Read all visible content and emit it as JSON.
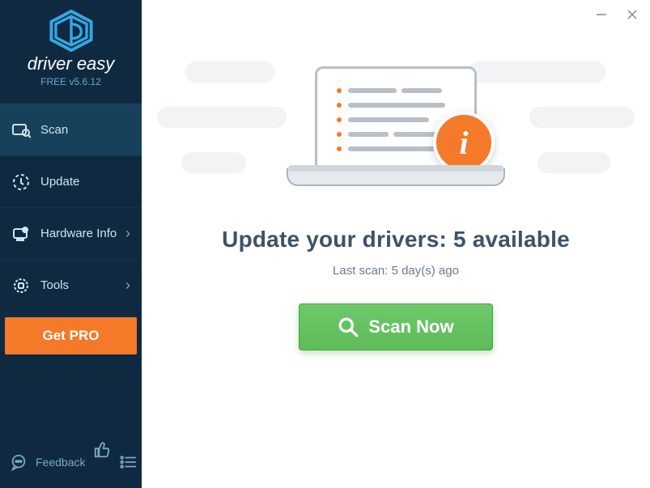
{
  "brand": {
    "name": "driver easy",
    "version": "FREE v5.6.12"
  },
  "sidebar": {
    "items": [
      {
        "label": "Scan",
        "chevron": false,
        "active": true
      },
      {
        "label": "Update",
        "chevron": false,
        "active": false
      },
      {
        "label": "Hardware Info",
        "chevron": true,
        "active": false
      },
      {
        "label": "Tools",
        "chevron": true,
        "active": false
      }
    ],
    "pro_button": "Get PRO",
    "feedback_label": "Feedback"
  },
  "main": {
    "headline": "Update your drivers: 5 available",
    "subline": "Last scan: 5 day(s) ago",
    "scan_button": "Scan Now"
  },
  "colors": {
    "sidebar_bg": "#0f2a40",
    "accent": "#f47a2a",
    "scan_green": "#5dbb58"
  }
}
